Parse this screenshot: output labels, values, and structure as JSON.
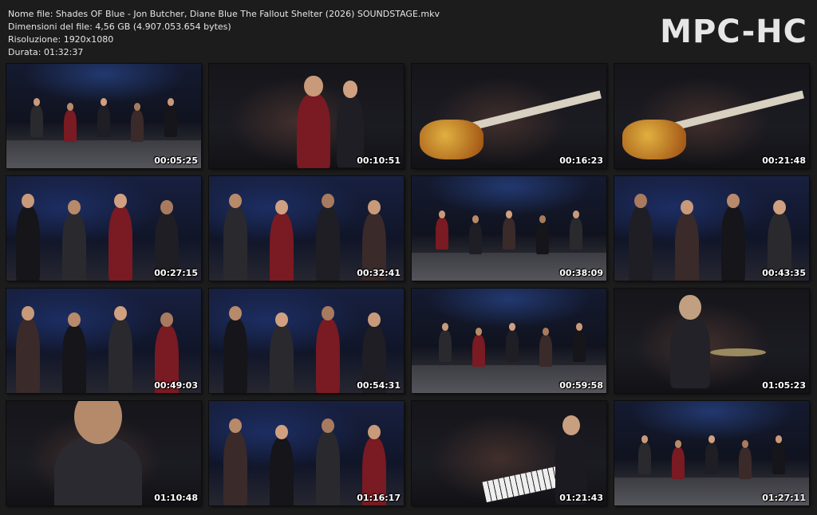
{
  "file_info": {
    "name_line": "Nome file: Shades OF Blue - Jon Butcher, Diane Blue The Fallout Shelter (2026) SOUNDSTAGE.mkv",
    "size_line": "Dimensioni del file: 4,56 GB (4.907.053.654 bytes)",
    "resolution_line": "Risoluzione: 1920x1080",
    "duration_line": "Durata: 01:32:37"
  },
  "logo": "MPC-HC",
  "thumbnails": [
    {
      "time": "00:05:25",
      "scene": "wide"
    },
    {
      "time": "00:10:51",
      "scene": "singer"
    },
    {
      "time": "00:16:23",
      "scene": "guitar-close"
    },
    {
      "time": "00:21:48",
      "scene": "guitar-close"
    },
    {
      "time": "00:27:15",
      "scene": "band"
    },
    {
      "time": "00:32:41",
      "scene": "band"
    },
    {
      "time": "00:38:09",
      "scene": "wide"
    },
    {
      "time": "00:43:35",
      "scene": "band"
    },
    {
      "time": "00:49:03",
      "scene": "band"
    },
    {
      "time": "00:54:31",
      "scene": "band"
    },
    {
      "time": "00:59:58",
      "scene": "wide"
    },
    {
      "time": "01:05:23",
      "scene": "drummer"
    },
    {
      "time": "01:10:48",
      "scene": "singer-close"
    },
    {
      "time": "01:16:17",
      "scene": "band"
    },
    {
      "time": "01:21:43",
      "scene": "organ"
    },
    {
      "time": "01:27:11",
      "scene": "wide"
    }
  ]
}
